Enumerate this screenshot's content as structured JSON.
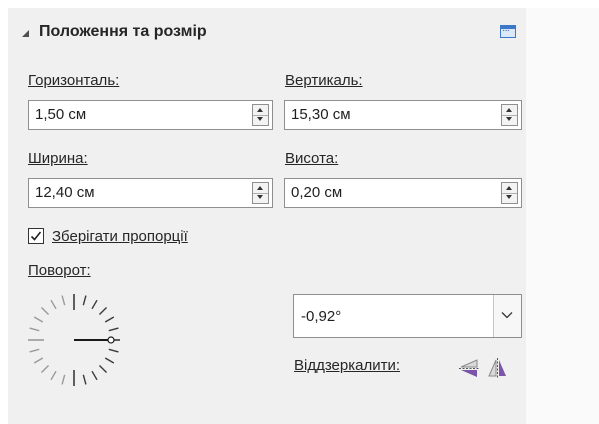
{
  "header": {
    "title": "Положення та розмір"
  },
  "position": {
    "horizontal_label": "Горизонталь:",
    "horizontal_value": "1,50 см",
    "vertical_label": "Вертикаль:",
    "vertical_value": "15,30 см"
  },
  "size": {
    "width_label": "Ширина:",
    "width_value": "12,40 см",
    "height_label": "Висота:",
    "height_value": "0,20 см",
    "keep_ratio_label": "Зберігати пропорції",
    "keep_ratio_checked": true
  },
  "rotation": {
    "label": "Поворот:",
    "value": "-0,92°",
    "dial_angle_deg": -0.92
  },
  "flip": {
    "label": "Віддзеркалити:"
  },
  "icons": [
    "collapse-triangle-icon",
    "panel-options-icon",
    "spin-up-icon",
    "spin-down-icon",
    "checkmark-icon",
    "rotation-dial-icon",
    "chevron-down-icon",
    "flip-vertical-icon",
    "flip-horizontal-icon"
  ],
  "colors": {
    "panel_bg": "#f0f0f0",
    "flip_icon_purple": "#7a55a8",
    "panel_options_blue": "#3c78c8"
  }
}
